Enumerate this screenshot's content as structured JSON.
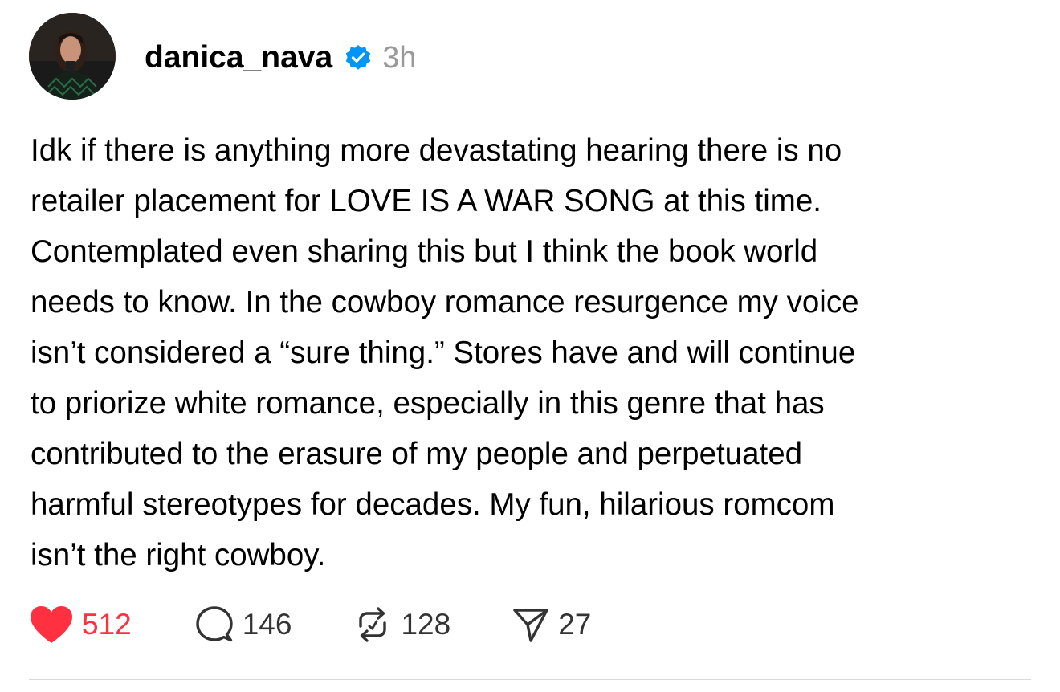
{
  "post": {
    "username": "danica_nava",
    "timestamp": "3h",
    "body": "Idk if there is anything more devastating hearing there is no\nretailer placement for LOVE IS A WAR SONG at this time.\nContemplated even sharing this but I think the book world\nneeds to know. In the cowboy romance resurgence my voice\nisn’t considered a “sure thing.” Stores have and will continue\nto priorize white romance, especially in this genre that has\ncontributed to the erasure of my people and perpetuated\nharmful stereotypes for decades. My fun, hilarious romcom\nisn’t the right cowboy.",
    "actions": {
      "likes": "512",
      "comments": "146",
      "reposts": "128",
      "shares": "27"
    },
    "icons": {
      "avatar": "avatar",
      "verified": "verified-badge-icon",
      "like": "heart-icon",
      "comment": "comment-icon",
      "repost": "repost-icon",
      "share": "send-icon"
    }
  },
  "colors": {
    "like_active": "#ff3040",
    "verified_blue": "#0095f6",
    "timestamp_gray": "#999999",
    "icon_gray": "#333333"
  }
}
